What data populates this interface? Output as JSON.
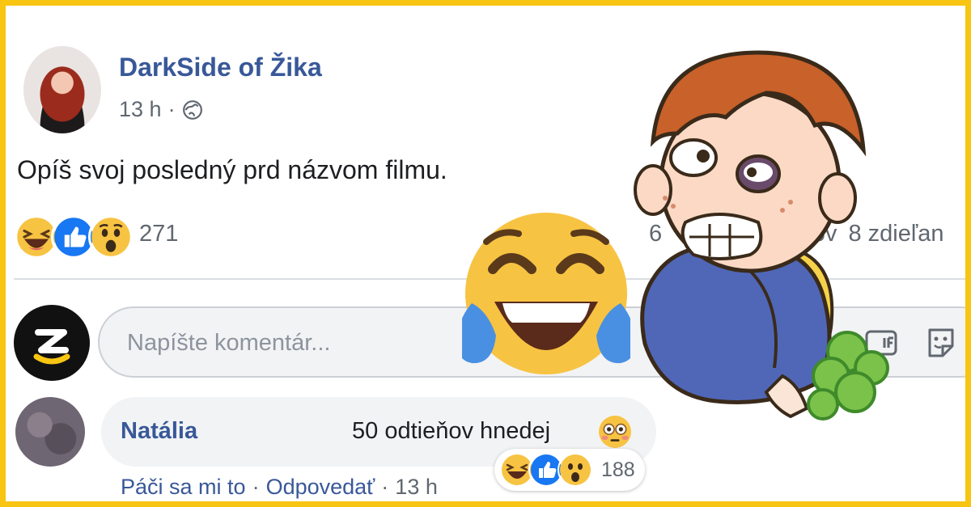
{
  "post": {
    "author": "DarkSide of Žika",
    "time": "13 h",
    "meta_separator": "·",
    "text": "Opíš svoj posledný prd názvom filmu.",
    "reaction_count": "271",
    "reactions": [
      "haha",
      "like",
      "wow"
    ],
    "comments_stat": "6",
    "comments_stat_suffix": "rov",
    "shares_stat": "8 zdieľan"
  },
  "composer": {
    "placeholder": "Napíšte komentár..."
  },
  "comment": {
    "author": "Natália",
    "text": "50 odtieňov hnedej",
    "emoji": "flushed",
    "like_label": "Páči sa mi to",
    "reply_label": "Odpovedať",
    "time": "13 h",
    "separator": "·",
    "reaction_count": "188",
    "reactions": [
      "haha",
      "like",
      "wow"
    ]
  },
  "icons": [
    "globe-icon",
    "gif-icon",
    "sticker-icon",
    "laughing-emoji",
    "like-icon",
    "wow-emoji",
    "tears-of-joy-emoji",
    "flushed-emoji"
  ],
  "colors": {
    "frame": "#f8c513",
    "link_blue": "#385898",
    "like_blue": "#1877f2",
    "emoji_yellow": "#f7c342",
    "tear_blue": "#4a90e2"
  }
}
